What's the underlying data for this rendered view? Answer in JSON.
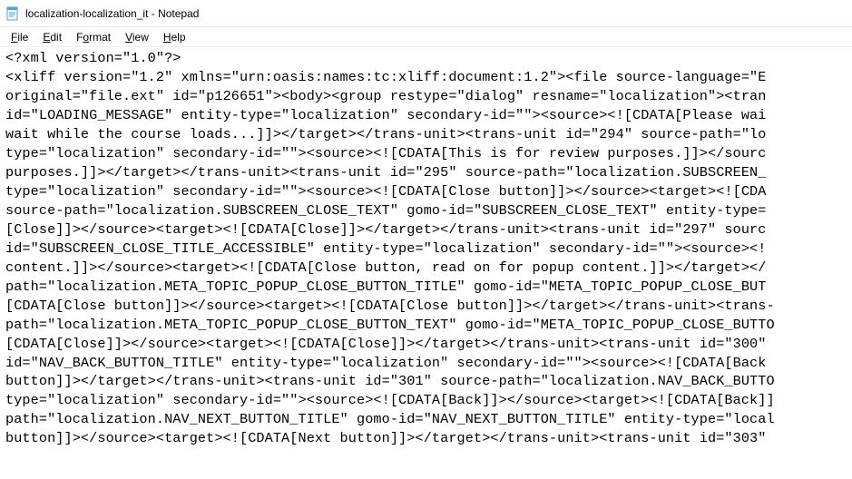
{
  "titlebar": {
    "document_name": "localization-localization_it",
    "app_name": "Notepad",
    "separator": " - "
  },
  "menubar": {
    "file": "File",
    "edit": "Edit",
    "format": "Format",
    "view": "View",
    "help": "Help"
  },
  "content": "<?xml version=\"1.0\"?>\n<xliff version=\"1.2\" xmlns=\"urn:oasis:names:tc:xliff:document:1.2\"><file source-language=\"E\noriginal=\"file.ext\" id=\"p126651\"><body><group restype=\"dialog\" resname=\"localization\"><tran\nid=\"LOADING_MESSAGE\" entity-type=\"localization\" secondary-id=\"\"><source><![CDATA[Please wai\nwait while the course loads...]]></target></trans-unit><trans-unit id=\"294\" source-path=\"lo\ntype=\"localization\" secondary-id=\"\"><source><![CDATA[This is for review purposes.]]></sourc\npurposes.]]></target></trans-unit><trans-unit id=\"295\" source-path=\"localization.SUBSCREEN_\ntype=\"localization\" secondary-id=\"\"><source><![CDATA[Close button]]></source><target><![CDA\nsource-path=\"localization.SUBSCREEN_CLOSE_TEXT\" gomo-id=\"SUBSCREEN_CLOSE_TEXT\" entity-type=\n[Close]]></source><target><![CDATA[Close]]></target></trans-unit><trans-unit id=\"297\" sourc\nid=\"SUBSCREEN_CLOSE_TITLE_ACCESSIBLE\" entity-type=\"localization\" secondary-id=\"\"><source><!\ncontent.]]></source><target><![CDATA[Close button, read on for popup content.]]></target></\npath=\"localization.META_TOPIC_POPUP_CLOSE_BUTTON_TITLE\" gomo-id=\"META_TOPIC_POPUP_CLOSE_BUT\n[CDATA[Close button]]></source><target><![CDATA[Close button]]></target></trans-unit><trans-\npath=\"localization.META_TOPIC_POPUP_CLOSE_BUTTON_TEXT\" gomo-id=\"META_TOPIC_POPUP_CLOSE_BUTTO\n[CDATA[Close]]></source><target><![CDATA[Close]]></target></trans-unit><trans-unit id=\"300\" \nid=\"NAV_BACK_BUTTON_TITLE\" entity-type=\"localization\" secondary-id=\"\"><source><![CDATA[Back \nbutton]]></target></trans-unit><trans-unit id=\"301\" source-path=\"localization.NAV_BACK_BUTTO\ntype=\"localization\" secondary-id=\"\"><source><![CDATA[Back]]></source><target><![CDATA[Back]]\npath=\"localization.NAV_NEXT_BUTTON_TITLE\" gomo-id=\"NAV_NEXT_BUTTON_TITLE\" entity-type=\"local\nbutton]]></source><target><![CDATA[Next button]]></target></trans-unit><trans-unit id=\"303\" "
}
